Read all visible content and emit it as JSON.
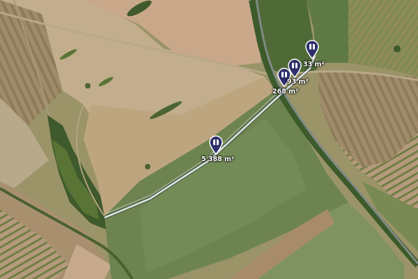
{
  "map": {
    "view": "satellite",
    "accent_color": "#2e2f6b",
    "parcels": [
      {
        "id": "p1",
        "area_label": "5 388 m²",
        "icon": "parcel-pin-icon"
      },
      {
        "id": "p2",
        "area_label": "268 m²",
        "icon": "parcel-pin-icon"
      },
      {
        "id": "p3",
        "area_label": "93 m²",
        "icon": "parcel-pin-icon"
      },
      {
        "id": "p4",
        "area_label": "33 m²",
        "icon": "parcel-pin-icon"
      }
    ]
  }
}
